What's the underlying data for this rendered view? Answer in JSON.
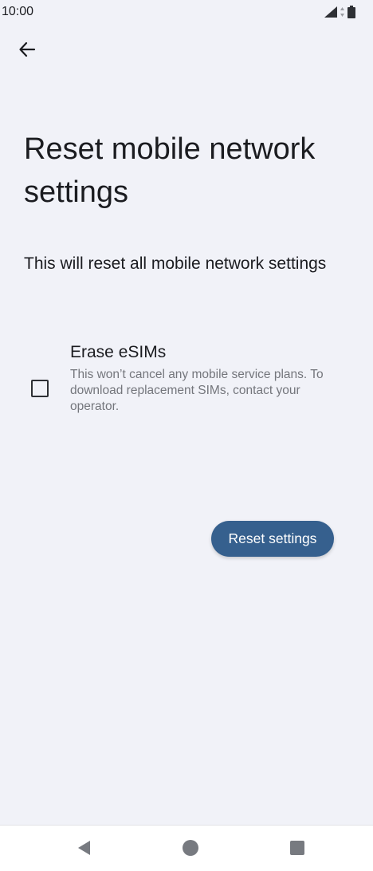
{
  "status_bar": {
    "time": "10:00",
    "icons": [
      "signal-icon",
      "data-icon",
      "battery-icon"
    ]
  },
  "header": {
    "back_icon": "arrow-back-icon"
  },
  "main": {
    "title": "Reset mobile network settings",
    "description": "This will reset all mobile network settings",
    "option": {
      "title": "Erase eSIMs",
      "summary": "This won’t cancel any mobile service plans. To download replacement SIMs, contact your operator.",
      "checked": false
    },
    "reset_button_label": "Reset settings"
  },
  "nav_bar": {
    "icons": [
      "back-triangle-icon",
      "home-circle-icon",
      "recents-square-icon"
    ]
  },
  "colors": {
    "background": "#f1f2f8",
    "accent": "#36608e",
    "text_primary": "#1b1c20",
    "text_secondary": "#74767c"
  }
}
